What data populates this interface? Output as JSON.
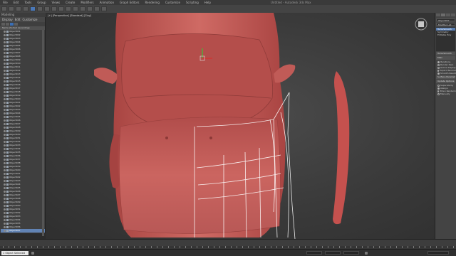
{
  "menu": {
    "items": [
      "File",
      "Edit",
      "Tools",
      "Group",
      "Views",
      "Create",
      "Modifiers",
      "Animation",
      "Graph Editors",
      "Rendering",
      "Customize",
      "Scripting",
      "Help"
    ]
  },
  "window": {
    "title": "Untitled - Autodesk 3ds Max"
  },
  "ribbon": {
    "label": "Modeling"
  },
  "explorer": {
    "tabs": [
      "Display",
      "Edit",
      "Customize"
    ],
    "column_header": "Name (Sorted Ascending)",
    "rows": [
      "Object001",
      "Object002",
      "Object003",
      "Object004",
      "Object005",
      "Object006",
      "Object007",
      "Object008",
      "Object009",
      "Object010",
      "Object011",
      "Object012",
      "Object013",
      "Object014",
      "Object015",
      "Object016",
      "Object017",
      "Object018",
      "Object019",
      "Object020",
      "Object021",
      "Object022",
      "Object023",
      "Object024",
      "Object025",
      "Object026",
      "Object027",
      "Object028",
      "Object029",
      "Object030",
      "Object031",
      "Object032",
      "Object033",
      "Object034",
      "Object035",
      "Object036",
      "Object037",
      "Object038",
      "Object039",
      "Object040",
      "Object041",
      "Object042",
      "Object043",
      "Object044",
      "Object045",
      "Object046",
      "Object047",
      "Object048",
      "Object049",
      "Object050",
      "Object051",
      "Object052",
      "Object053",
      "Object054",
      "Object055",
      "Object056",
      "Object057"
    ],
    "selected_row": "Object057"
  },
  "viewport": {
    "label": "[+] [Perspective] [Standard] [Clay]"
  },
  "command_panel": {
    "object_name": "Object057",
    "modifier_list": "Modifier List",
    "stack": [
      "TurboSmooth",
      "Symmetry",
      "Editable Poly"
    ],
    "rollouts": [
      "TurboSmooth",
      "Main",
      "Surface Parameters",
      "Update Options"
    ],
    "options": [
      {
        "label": "Iterations",
        "on": true
      },
      {
        "label": "Render Iters",
        "on": false
      },
      {
        "label": "Isoline Display",
        "on": false
      },
      {
        "label": "Explicit Normals",
        "on": false
      },
      {
        "label": "Smooth Result",
        "on": true
      },
      {
        "label": "Separate by",
        "on": false
      },
      {
        "label": "Always",
        "on": true
      },
      {
        "label": "When Rendering",
        "on": false
      },
      {
        "label": "Manually",
        "on": false
      }
    ]
  },
  "status": {
    "selection": "1 Object Selected"
  },
  "colors": {
    "car_body": "#c75a56",
    "wire": "#ffffff"
  }
}
